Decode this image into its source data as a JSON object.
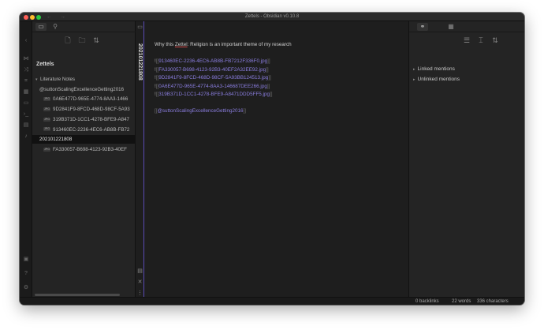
{
  "window": {
    "title": "Zettels - Obsidian v0.10.8",
    "nav_arrows": "← →"
  },
  "ribbon": {
    "icons": [
      "collapse-left-icon",
      "graph-icon",
      "random-note-icon",
      "tag-icon",
      "calendar-icon",
      "document-icon",
      "command-icon",
      "archive-icon",
      "microphone-icon",
      "publish-icon",
      "help-icon",
      "settings-icon"
    ]
  },
  "left_sidebar": {
    "tabs": [
      {
        "name": "file-explorer-tab",
        "glyph": "▭",
        "active": true
      },
      {
        "name": "search-tab",
        "glyph": "⚲",
        "active": false
      }
    ],
    "actions": [
      {
        "name": "new-note-button",
        "glyph": "🗋"
      },
      {
        "name": "new-folder-button",
        "glyph": "🗀"
      },
      {
        "name": "sort-button",
        "glyph": "⇅"
      }
    ],
    "vault_name": "Zettels",
    "tree": [
      {
        "kind": "folder",
        "label": "Literature Notes",
        "arrow": "▾",
        "indent": 4
      },
      {
        "kind": "file",
        "label": "@suttonScalingExcellenceGetting2016",
        "indent": 9
      },
      {
        "kind": "attachment",
        "tag": "JPG",
        "label": "0A6E477D-965E-4774-8AA3-1466",
        "indent": 14
      },
      {
        "kind": "attachment",
        "tag": "JPG",
        "label": "9D2841F9-8FCD-468D-98CF-5A93",
        "indent": 14
      },
      {
        "kind": "attachment",
        "tag": "JPG",
        "label": "319B371D-1CC1-4278-BFE9-A847",
        "indent": 14
      },
      {
        "kind": "attachment",
        "tag": "JPG",
        "label": "913460EC-2236-4EC6-AB8B-FB72",
        "indent": 14
      },
      {
        "kind": "file",
        "label": "202101221808",
        "indent": 9,
        "selected": true
      },
      {
        "kind": "attachment",
        "tag": "JPG",
        "label": "FA330057-B698-4123-92B3-40EF",
        "indent": 14
      }
    ]
  },
  "editor": {
    "note_title": "202101221808",
    "line1_before": "Why this ",
    "line1_word": "Zettel",
    "line1_after": ": Religion is an important theme of my research",
    "embeds": [
      "913460EC-2236-4EC6-AB8B-FB7212F336F0.jpg",
      "FA330057-B698-4123-92B3-40EF2A32EE92.jpg",
      "9D2841F9-8FCD-468D-98CF-5A93BB124513.jpg",
      "0A6E477D-965E-4774-8AA3-146687DEE266.jpg",
      "319B371D-1CC1-4278-BFE9-A8471DDD5FF5.jpg"
    ],
    "embed_prefix": "!",
    "bracket_open": "[[",
    "bracket_close": "]]",
    "citation_link": "@suttonScalingExcellenceGetting2016",
    "strip_icons": [
      "open-file-icon",
      "backlinks-pane-icon",
      "close-pane-icon",
      "more-options-icon"
    ]
  },
  "right_sidebar": {
    "tabs": [
      {
        "name": "backlinks-tab",
        "glyph": "🔗",
        "active": true
      },
      {
        "name": "calendar-tab",
        "glyph": "▦",
        "active": false
      }
    ],
    "actions": [
      {
        "name": "collapse-results-button",
        "glyph": "☰"
      },
      {
        "name": "show-more-context-button",
        "glyph": "⌶"
      },
      {
        "name": "sort-backlinks-button",
        "glyph": "⇅"
      }
    ],
    "linked_mentions": "Linked mentions",
    "unlinked_mentions": "Unlinked mentions",
    "caret": "▸"
  },
  "status_bar": {
    "backlinks": "0 backlinks",
    "words": "22 words",
    "characters": "336 characters"
  },
  "colors": {
    "background": "#1e1e1e",
    "accent": "#8b7ee0",
    "text": "#d0d0d0"
  }
}
